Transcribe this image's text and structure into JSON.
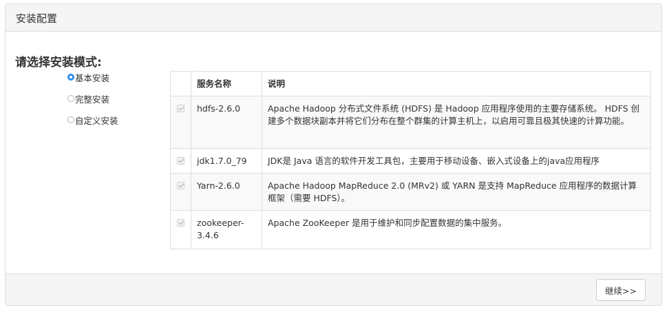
{
  "panel": {
    "title": "安装配置",
    "continue_label": "继续>>"
  },
  "install_mode": {
    "heading": "请选择安装模式:",
    "options": [
      {
        "label": "基本安装",
        "selected": true
      },
      {
        "label": "完整安装",
        "selected": false
      },
      {
        "label": "自定义安装",
        "selected": false
      }
    ]
  },
  "services": {
    "headers": {
      "name": "服务名称",
      "description": "说明"
    },
    "rows": [
      {
        "checked": true,
        "name": "hdfs-2.6.0",
        "description": "Apache Hadoop 分布式文件系统 (HDFS) 是 Hadoop 应用程序使用的主要存储系统。 HDFS 创建多个数据块副本并将它们分布在整个群集的计算主机上，以启用可靠且极其快速的计算功能。"
      },
      {
        "checked": true,
        "name": "jdk1.7.0_79",
        "description": "JDK是 Java 语言的软件开发工具包，主要用于移动设备、嵌入式设备上的java应用程序"
      },
      {
        "checked": true,
        "name": "Yarn-2.6.0",
        "description": "Apache Hadoop MapReduce 2.0 (MRv2) 或 YARN 是支持 MapReduce 应用程序的数据计算框架（需要 HDFS）。"
      },
      {
        "checked": true,
        "name": "zookeeper-3.4.6",
        "description": "Apache ZooKeeper 是用于维护和同步配置数据的集中服务。"
      }
    ]
  }
}
